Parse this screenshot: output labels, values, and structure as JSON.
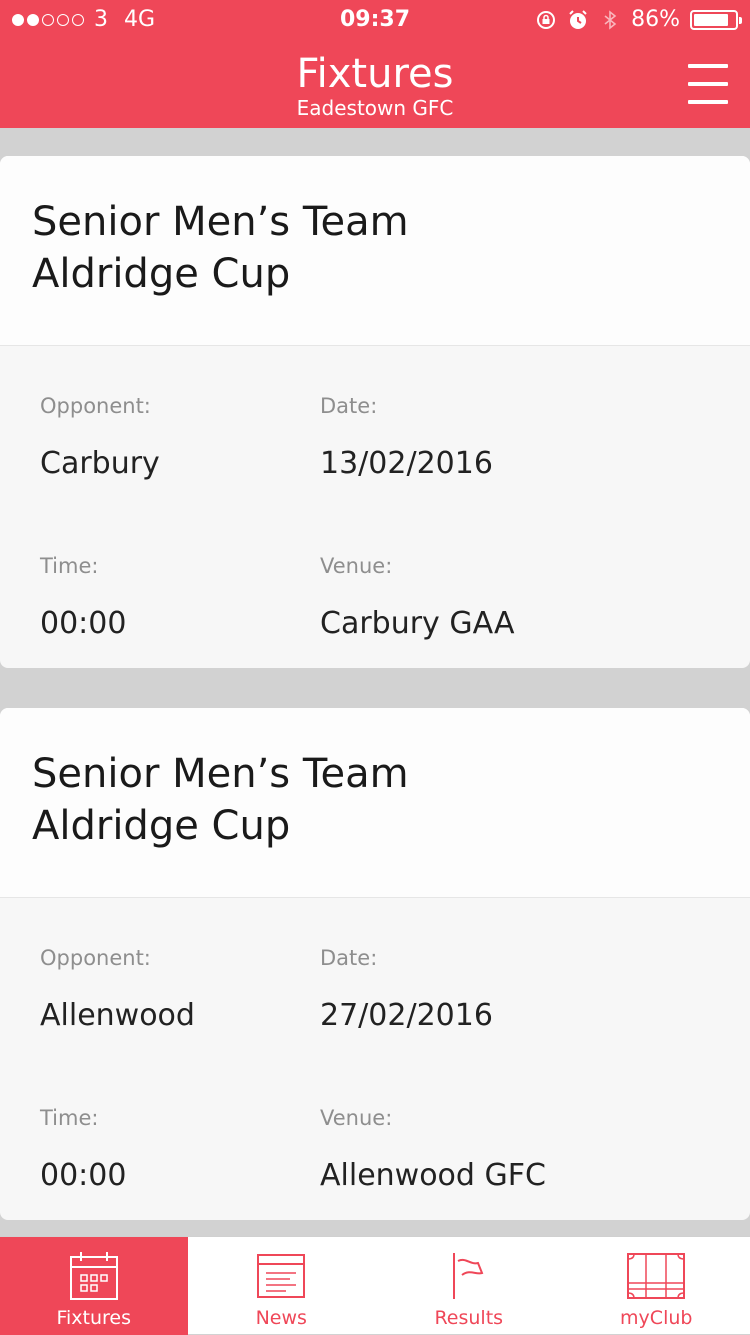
{
  "status_bar": {
    "carrier": "3",
    "network": "4G",
    "time": "09:37",
    "battery_percent": "86%",
    "battery_level": 0.86,
    "signal_bars_filled": 2,
    "signal_bars_total": 5
  },
  "header": {
    "title": "Fixtures",
    "subtitle": "Eadestown GFC",
    "menu_icon": "hamburger-menu-icon"
  },
  "colors": {
    "accent": "#ef4758",
    "background": "#d2d2d2",
    "card": "#f7f7f7"
  },
  "fixtures": [
    {
      "team": "Senior Men’s Team",
      "competition": "Aldridge Cup",
      "opponent_label": "Opponent:",
      "opponent": "Carbury",
      "date_label": "Date:",
      "date": "13/02/2016",
      "time_label": "Time:",
      "time": "00:00",
      "venue_label": "Venue:",
      "venue": "Carbury GAA"
    },
    {
      "team": "Senior Men’s Team",
      "competition": "Aldridge Cup",
      "opponent_label": "Opponent:",
      "opponent": "Allenwood",
      "date_label": "Date:",
      "date": "27/02/2016",
      "time_label": "Time:",
      "time": "00:00",
      "venue_label": "Venue:",
      "venue": "Allenwood GFC"
    }
  ],
  "tabs": [
    {
      "label": "Fixtures",
      "icon": "calendar-icon",
      "active": true
    },
    {
      "label": "News",
      "icon": "newspaper-icon",
      "active": false
    },
    {
      "label": "Results",
      "icon": "flag-icon",
      "active": false
    },
    {
      "label": "myClub",
      "icon": "pitch-icon",
      "active": false
    }
  ]
}
